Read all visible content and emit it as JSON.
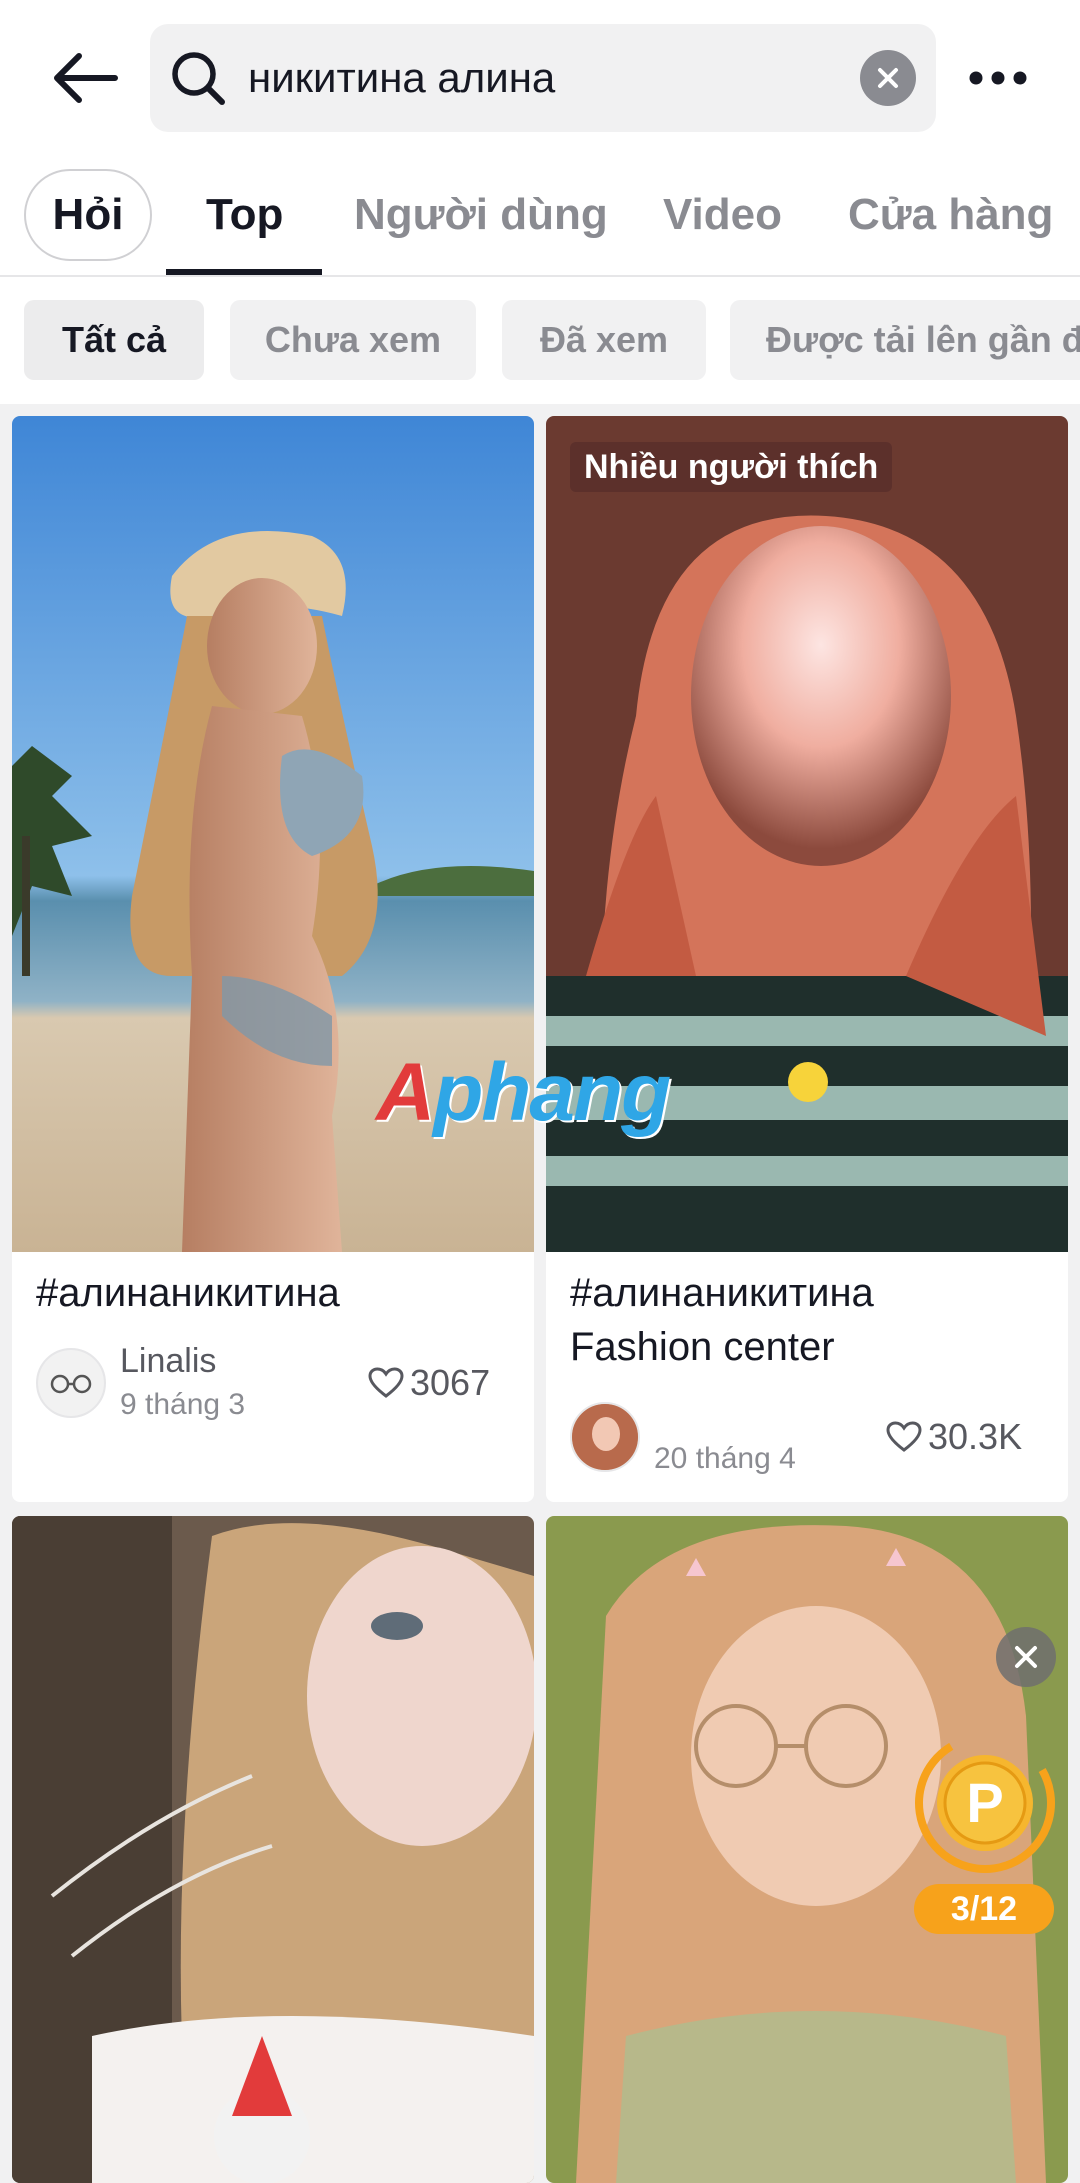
{
  "search": {
    "query": "никитина алина"
  },
  "tabs": {
    "ask": "Hỏi",
    "items": [
      {
        "label": "Top"
      },
      {
        "label": "Người dùng"
      },
      {
        "label": "Video"
      },
      {
        "label": "Cửa hàng"
      }
    ]
  },
  "filters": [
    {
      "label": "Tất cả"
    },
    {
      "label": "Chưa xem"
    },
    {
      "label": "Đã xem"
    },
    {
      "label": "Được tải lên gần đây"
    }
  ],
  "watermark": {
    "first": "A",
    "rest": "phang"
  },
  "cards": [
    {
      "title": "#алинаникитина",
      "author": "Linalis",
      "date": "9 tháng 3",
      "likes": "3067"
    },
    {
      "badge": "Nhiều người thích",
      "title": "#алинаникитина",
      "subtitle": "Fashion center",
      "date": "20 tháng 4",
      "likes": "30.3K"
    },
    {},
    {}
  ],
  "coin_widget": {
    "icon": "P",
    "progress": "3/12"
  },
  "colors": {
    "accent_orange": "#f7a21b",
    "text_primary": "#161823",
    "text_secondary": "#8a8b91"
  }
}
